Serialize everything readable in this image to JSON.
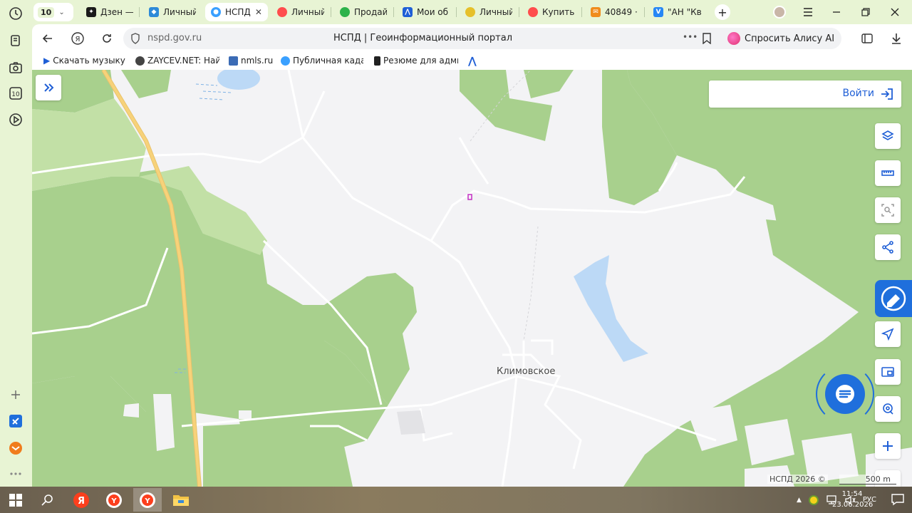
{
  "tabs": {
    "counter": "10",
    "items": [
      {
        "label": "Дзен —",
        "color": "#1a1a1a",
        "active": false
      },
      {
        "label": "Личный",
        "color": "#2d8ad8",
        "active": false
      },
      {
        "label": "НСПД",
        "color": "#3aa0ff",
        "active": true
      },
      {
        "label": "Личный",
        "color": "#ff4d4d",
        "active": false
      },
      {
        "label": "Продай",
        "color": "#2cb24a",
        "active": false
      },
      {
        "label": "Мои об",
        "color": "#1f5fd6",
        "active": false
      },
      {
        "label": "Личный",
        "color": "#e6c02a",
        "active": false
      },
      {
        "label": "Купить",
        "color": "#ff4d4d",
        "active": false
      },
      {
        "label": "40849 ·",
        "color": "#f08c1c",
        "active": false
      },
      {
        "label": "\"АН \"Кв",
        "color": "#2787f5",
        "active": false
      }
    ],
    "new_tab": "+"
  },
  "navbar": {
    "url": "nspd.gov.ru",
    "page_title": "НСПД | Геоинформационный портал",
    "more": "•••",
    "alice_label": "Спросить Алису AI"
  },
  "bookmarks": [
    {
      "label": "Скачать музыку б",
      "color": "#1f5fd6"
    },
    {
      "label": "ZAYCEV.NET: Най",
      "color": "#444444"
    },
    {
      "label": "nmls.ru",
      "color": "#3b6bb5"
    },
    {
      "label": "Публичная кадас",
      "color": "#3aa0ff"
    },
    {
      "label": "Резюме для адми",
      "color": "#222222"
    }
  ],
  "map": {
    "login_label": "Войти",
    "village_label": "Климовское",
    "copyright": "НСПД 2026 ©",
    "scale_label": "500 m",
    "colors": {
      "forest": "#a8d08d",
      "forest_light": "#c2e0a6",
      "background": "#f3f3f5",
      "water": "#bcd9f6",
      "road_main": "#f7d27a",
      "accent": "#1f6fdc"
    }
  },
  "taskbar": {
    "lang": "РУС",
    "time": "11:54",
    "date": "23.06.2026"
  }
}
